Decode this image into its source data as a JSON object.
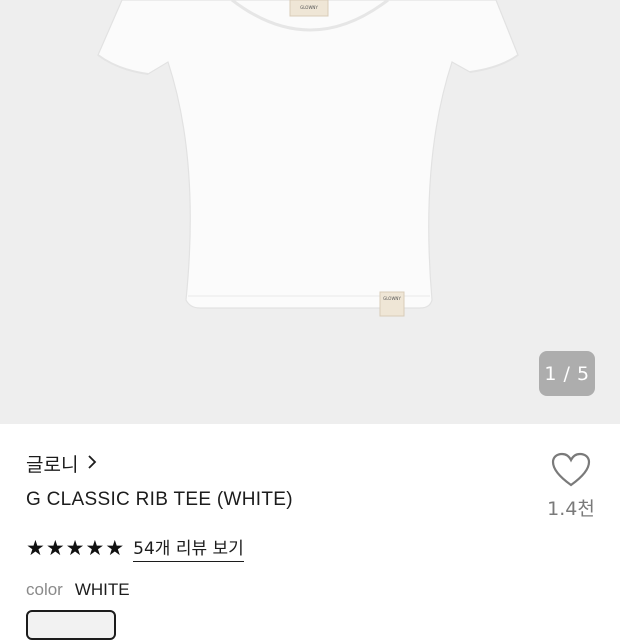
{
  "gallery": {
    "image_alt": "white ribbed short sleeve tee",
    "label_text": "GLOWNY",
    "pager": "1 / 5",
    "bg_color": "#eeeeee"
  },
  "product": {
    "brand": "글로니",
    "name": "G CLASSIC RIB TEE (WHITE)",
    "like_count": "1.4천",
    "rating_stars": 5,
    "review_link": "54개 리뷰 보기",
    "color_label": "color",
    "color_value": "WHITE"
  },
  "icons": {
    "brand_arrow": "chevron-right-icon",
    "like": "heart-outline-icon",
    "star": "star-filled-icon"
  }
}
